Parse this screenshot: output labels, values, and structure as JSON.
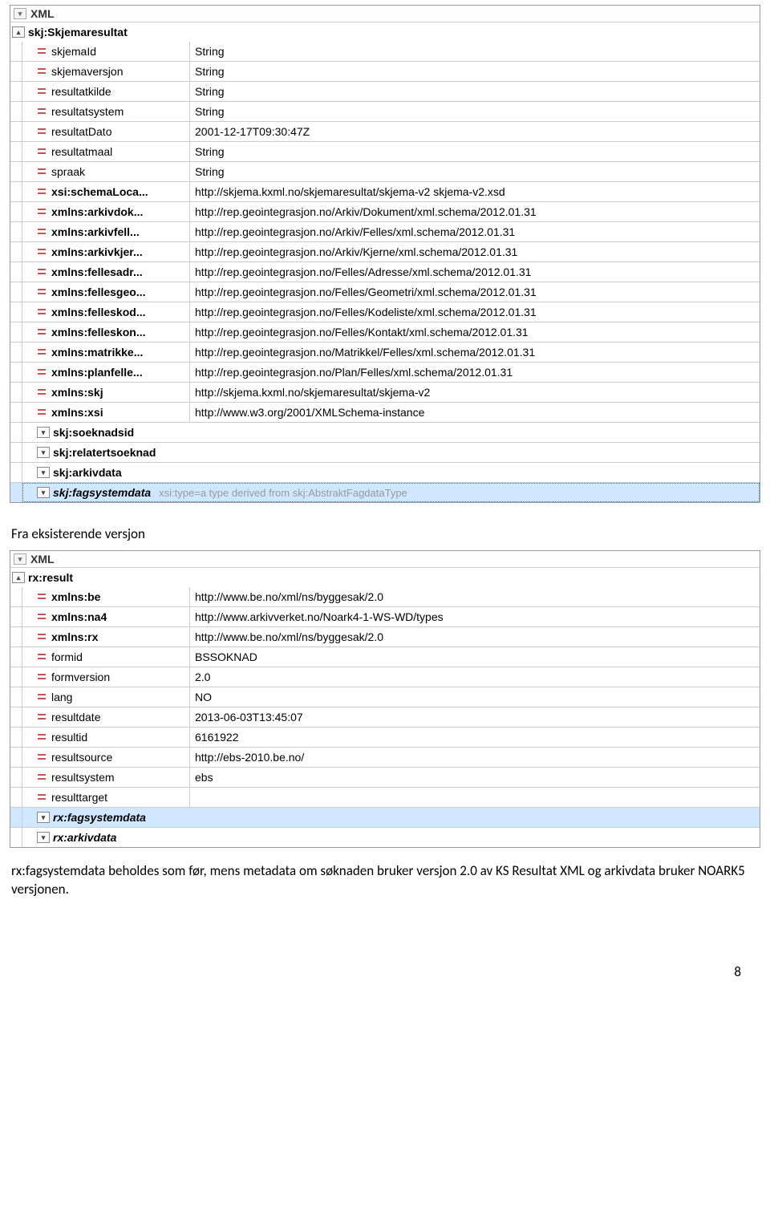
{
  "panel1": {
    "header": "XML",
    "rootLabel": "skj:Skjemaresultat",
    "rows": [
      {
        "icon": "attr",
        "name": "skjemaId",
        "value": "String"
      },
      {
        "icon": "attr",
        "name": "skjemaversjon",
        "value": "String"
      },
      {
        "icon": "attr",
        "name": "resultatkilde",
        "value": "String"
      },
      {
        "icon": "attr",
        "name": "resultatsystem",
        "value": "String"
      },
      {
        "icon": "attr",
        "name": "resultatDato",
        "value": "2001-12-17T09:30:47Z"
      },
      {
        "icon": "attr",
        "name": "resultatmaal",
        "value": "String"
      },
      {
        "icon": "attr",
        "name": "spraak",
        "value": "String"
      },
      {
        "icon": "attr",
        "name": "xsi:schemaLoca...",
        "bold": true,
        "value": "http://skjema.kxml.no/skjemaresultat/skjema-v2 skjema-v2.xsd"
      },
      {
        "icon": "attr",
        "name": "xmlns:arkivdok...",
        "bold": true,
        "value": "http://rep.geointegrasjon.no/Arkiv/Dokument/xml.schema/2012.01.31"
      },
      {
        "icon": "attr",
        "name": "xmlns:arkivfell...",
        "bold": true,
        "value": "http://rep.geointegrasjon.no/Arkiv/Felles/xml.schema/2012.01.31"
      },
      {
        "icon": "attr",
        "name": "xmlns:arkivkjer...",
        "bold": true,
        "value": "http://rep.geointegrasjon.no/Arkiv/Kjerne/xml.schema/2012.01.31"
      },
      {
        "icon": "attr",
        "name": "xmlns:fellesadr...",
        "bold": true,
        "value": "http://rep.geointegrasjon.no/Felles/Adresse/xml.schema/2012.01.31"
      },
      {
        "icon": "attr",
        "name": "xmlns:fellesgeo...",
        "bold": true,
        "value": "http://rep.geointegrasjon.no/Felles/Geometri/xml.schema/2012.01.31"
      },
      {
        "icon": "attr",
        "name": "xmlns:felleskod...",
        "bold": true,
        "value": "http://rep.geointegrasjon.no/Felles/Kodeliste/xml.schema/2012.01.31"
      },
      {
        "icon": "attr",
        "name": "xmlns:felleskon...",
        "bold": true,
        "value": "http://rep.geointegrasjon.no/Felles/Kontakt/xml.schema/2012.01.31"
      },
      {
        "icon": "attr",
        "name": "xmlns:matrikke...",
        "bold": true,
        "value": "http://rep.geointegrasjon.no/Matrikkel/Felles/xml.schema/2012.01.31"
      },
      {
        "icon": "attr",
        "name": "xmlns:planfelle...",
        "bold": true,
        "value": "http://rep.geointegrasjon.no/Plan/Felles/xml.schema/2012.01.31"
      },
      {
        "icon": "attr",
        "name": "xmlns:skj",
        "bold": true,
        "value": "http://skjema.kxml.no/skjemaresultat/skjema-v2"
      },
      {
        "icon": "attr",
        "name": "xmlns:xsi",
        "bold": true,
        "value": "http://www.w3.org/2001/XMLSchema-instance"
      },
      {
        "icon": "expand",
        "name": "skj:soeknadsid",
        "bold": true
      },
      {
        "icon": "expand",
        "name": "skj:relatertsoeknad",
        "bold": true
      },
      {
        "icon": "expand",
        "name": "skj:arkivdata",
        "bold": true
      },
      {
        "icon": "expand",
        "name": "skj:fagsystemdata",
        "bold": true,
        "italic": true,
        "highlight": true,
        "dotted": true,
        "hint": "xsi:type=a type derived from skj:AbstraktFagdataType"
      }
    ]
  },
  "caption1": "Fra eksisterende versjon",
  "panel2": {
    "header": "XML",
    "rootLabel": "rx:result",
    "rows": [
      {
        "icon": "attr",
        "name": "xmlns:be",
        "bold": true,
        "value": "http://www.be.no/xml/ns/byggesak/2.0"
      },
      {
        "icon": "attr",
        "name": "xmlns:na4",
        "bold": true,
        "value": "http://www.arkivverket.no/Noark4-1-WS-WD/types"
      },
      {
        "icon": "attr",
        "name": "xmlns:rx",
        "bold": true,
        "value": "http://www.be.no/xml/ns/byggesak/2.0"
      },
      {
        "icon": "attr",
        "name": "formid",
        "value": "BSSOKNAD"
      },
      {
        "icon": "attr",
        "name": "formversion",
        "value": "2.0"
      },
      {
        "icon": "attr",
        "name": "lang",
        "value": "NO"
      },
      {
        "icon": "attr",
        "name": "resultdate",
        "value": "2013-06-03T13:45:07"
      },
      {
        "icon": "attr",
        "name": "resultid",
        "value": "6161922"
      },
      {
        "icon": "attr",
        "name": "resultsource",
        "value": "http://ebs-2010.be.no/"
      },
      {
        "icon": "attr",
        "name": "resultsystem",
        "value": "ebs"
      },
      {
        "icon": "attr",
        "name": "resulttarget",
        "value": ""
      },
      {
        "icon": "expand",
        "name": "rx:fagsystemdata",
        "bold": true,
        "italic": true,
        "highlight": true
      },
      {
        "icon": "expand",
        "name": "rx:arkivdata",
        "bold": true,
        "italic": true
      }
    ]
  },
  "paragraph": "rx:fagsystemdata beholdes som før, mens metadata om søknaden bruker versjon 2.0 av KS Resultat XML og arkivdata bruker NOARK5 versjonen.",
  "pagenum": "8"
}
